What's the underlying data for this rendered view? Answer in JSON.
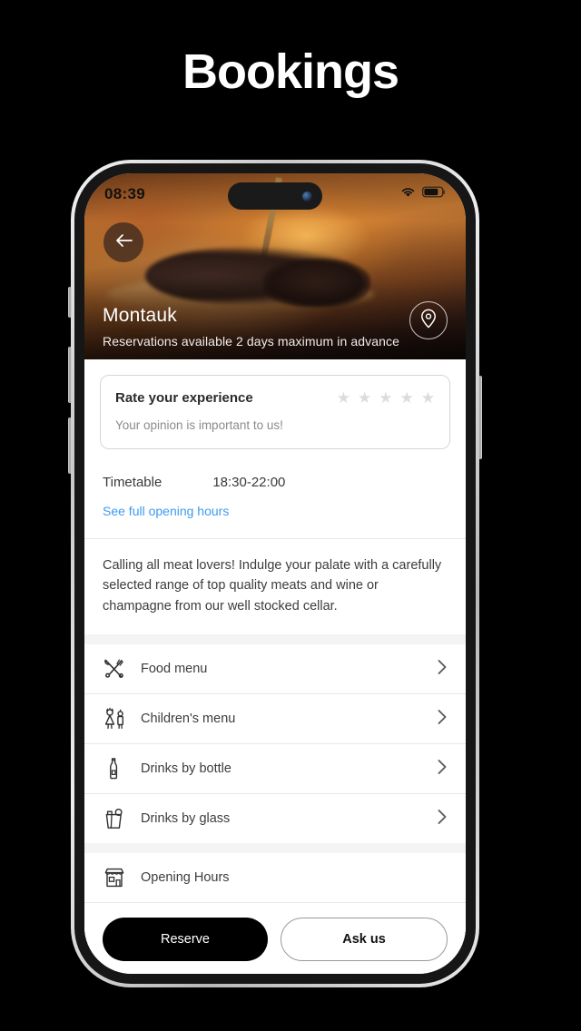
{
  "page": {
    "title": "Bookings"
  },
  "status_bar": {
    "time": "08:39",
    "wifi_icon": "wifi-icon",
    "battery_icon": "battery-icon"
  },
  "hero": {
    "back_icon": "arrow-left-icon",
    "title": "Montauk",
    "subtitle": "Reservations available 2 days maximum in advance",
    "location_icon": "location-pin-icon"
  },
  "rating_card": {
    "title": "Rate your experience",
    "subtitle": "Your opinion is important to us!",
    "star_glyph": "★",
    "star_count": 5,
    "star_color": "#dcdcde"
  },
  "timetable": {
    "label": "Timetable",
    "value": "18:30-22:00",
    "link": "See full opening hours",
    "link_color": "#3d9bf0"
  },
  "description": "Calling all meat lovers! Indulge your palate with a carefully selected range of top quality meats and wine or champagne from our well stocked cellar.",
  "menu_rows": [
    {
      "label": "Food menu",
      "icon": "cutlery-icon",
      "chevron": "chevron-right-icon"
    },
    {
      "label": "Children's menu",
      "icon": "children-icon",
      "chevron": "chevron-right-icon"
    },
    {
      "label": "Drinks by bottle",
      "icon": "bottle-icon",
      "chevron": "chevron-right-icon"
    },
    {
      "label": "Drinks by glass",
      "icon": "glass-icon",
      "chevron": "chevron-right-icon"
    }
  ],
  "info_rows": [
    {
      "label": "Opening Hours",
      "icon": "storefront-icon"
    }
  ],
  "footer": {
    "reserve_label": "Reserve",
    "ask_label": "Ask us",
    "reserve_bg": "#000000",
    "ask_border": "#9a9a9a"
  }
}
